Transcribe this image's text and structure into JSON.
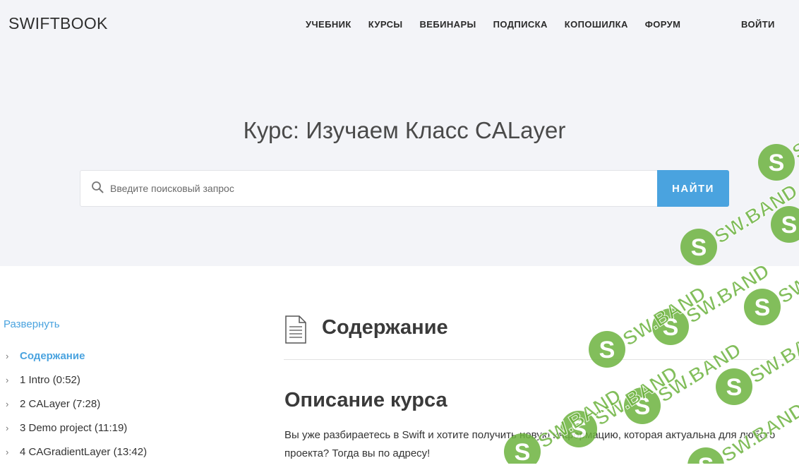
{
  "header": {
    "logo": "SWIFTBOOK",
    "nav": [
      "УЧЕБНИК",
      "КУРСЫ",
      "ВЕБИНАРЫ",
      "ПОДПИСКА",
      "КОПОШИЛКА",
      "ФОРУМ"
    ],
    "login": "ВОЙТИ"
  },
  "hero": {
    "title": "Курс: Изучаем Класс CALayer",
    "search_placeholder": "Введите поисковый запрос",
    "search_button": "НАЙТИ"
  },
  "sidebar": {
    "expand_label": "Развернуть",
    "items": [
      {
        "label": "Содержание",
        "active": true
      },
      {
        "label": "1 Intro (0:52)",
        "active": false
      },
      {
        "label": "2 CALayer (7:28)",
        "active": false
      },
      {
        "label": "3 Demo project (11:19)",
        "active": false
      },
      {
        "label": "4 CAGradientLayer (13:42)",
        "active": false
      }
    ]
  },
  "main": {
    "contents_title": "Содержание",
    "description_title": "Описание курса",
    "description_text": "Вы уже разбираетесь в Swift и хотите получить новую информацию, которая актуальна для любого проекта? Тогда вы по адресу!"
  },
  "watermark": {
    "text": "SW.BAND",
    "letter": "S",
    "color": "#6db33f"
  },
  "colors": {
    "accent": "#4aa3df",
    "hero_bg": "#f3f4f8"
  }
}
